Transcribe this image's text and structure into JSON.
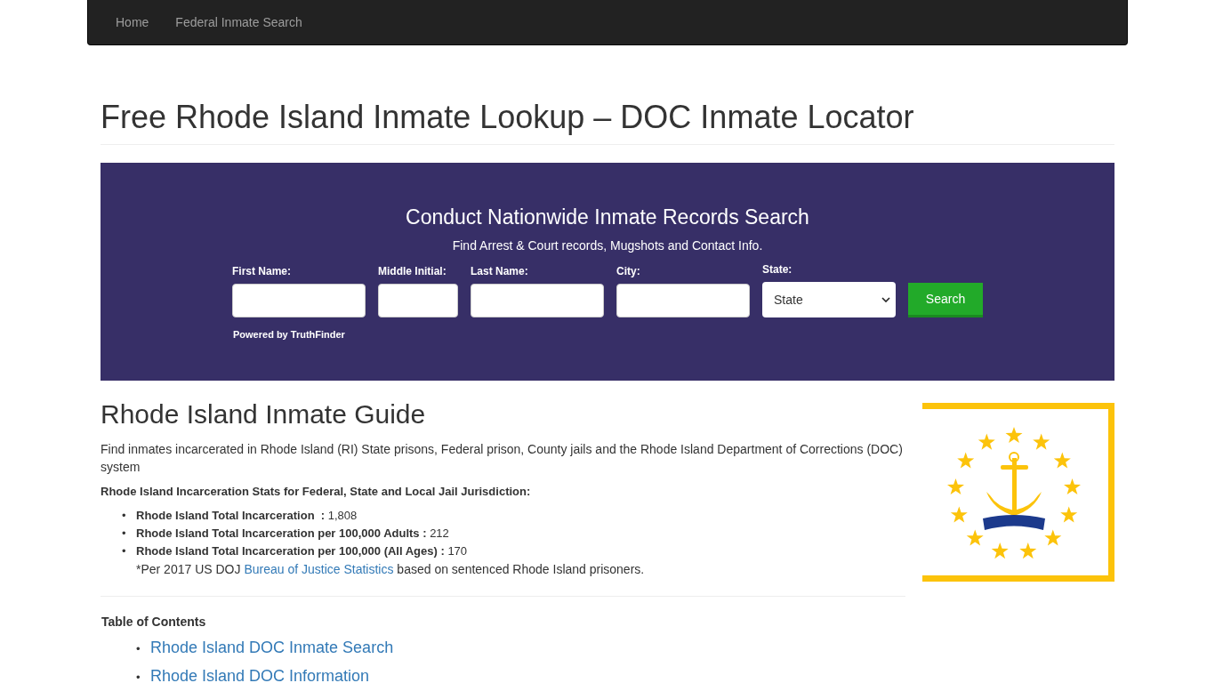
{
  "navbar": {
    "items": [
      {
        "label": "Home"
      },
      {
        "label": "Federal Inmate Search"
      }
    ]
  },
  "page_title": "Free Rhode Island Inmate Lookup – DOC Inmate Locator",
  "search_banner": {
    "title": "Conduct Nationwide Inmate Records Search",
    "subtitle": "Find Arrest & Court records, Mugshots and Contact Info.",
    "fields": [
      {
        "label": "First Name:",
        "kind": "text"
      },
      {
        "label": "Middle Initial:",
        "kind": "initial"
      },
      {
        "label": "Last Name:",
        "kind": "text"
      },
      {
        "label": "City:",
        "kind": "text"
      },
      {
        "label": "State:",
        "kind": "select",
        "value": "State"
      }
    ],
    "button": "Search",
    "powered_by": "Powered by TruthFinder"
  },
  "guide": {
    "heading": "Rhode Island Inmate Guide",
    "intro": "Find inmates incarcerated in Rhode Island (RI) State prisons, Federal prison, County jails and the Rhode Island Department of Corrections (DOC) system",
    "stats_heading": "Rhode Island Incarceration Stats for Federal, State and Local Jail Jurisdiction:",
    "stats": [
      {
        "marker": "•",
        "label": "Rhode Island Total Incarceration  :",
        "value": "1,808"
      },
      {
        "marker": "•",
        "label": "Rhode Island Total Incarceration per 100,000 Adults :",
        "value": "212"
      },
      {
        "marker": "•",
        "label": "Rhode Island Total Incarceration per 100,000 (All Ages) :",
        "value": "170"
      }
    ],
    "note": {
      "before": "*Per 2017 US DOJ",
      "link": "Bureau of Justice Statistics",
      "after": "based on sentenced Rhode Island prisoners."
    }
  },
  "toc": {
    "heading": "Table of Contents",
    "items": [
      {
        "marker": "•",
        "label": "Rhode Island DOC Inmate Search"
      },
      {
        "marker": "•",
        "label": "Rhode Island DOC Information"
      }
    ]
  }
}
